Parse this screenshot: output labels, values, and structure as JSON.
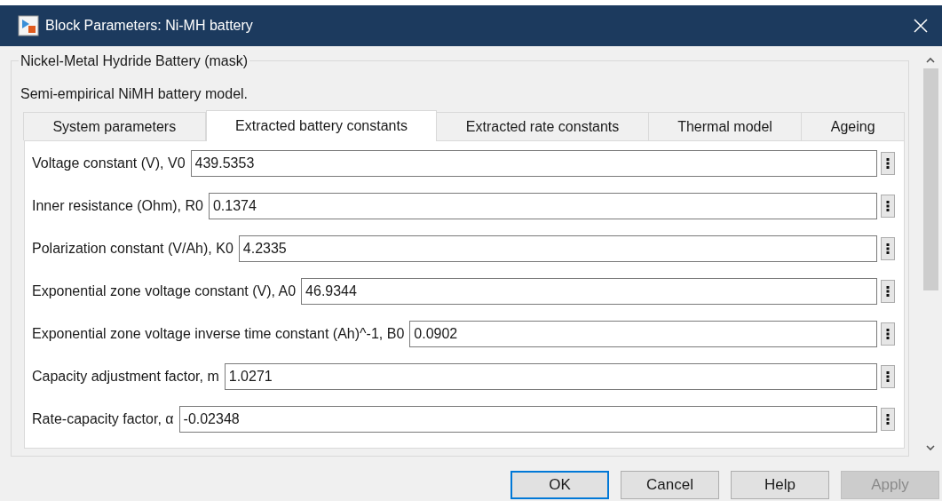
{
  "window": {
    "title": "Block Parameters: Ni-MH battery"
  },
  "group": {
    "title": "Nickel-Metal Hydride Battery (mask)",
    "description": "Semi-empirical NiMH battery model."
  },
  "tabs": [
    {
      "label": "System parameters",
      "selected": false
    },
    {
      "label": "Extracted battery constants",
      "selected": true
    },
    {
      "label": "Extracted rate constants",
      "selected": false
    },
    {
      "label": "Thermal model",
      "selected": false
    },
    {
      "label": "Ageing",
      "selected": false
    }
  ],
  "parameters": [
    {
      "label": "Voltage constant (V), V0",
      "value": "439.5353"
    },
    {
      "label": "Inner resistance (Ohm), R0",
      "value": "0.1374"
    },
    {
      "label": "Polarization constant (V/Ah), K0",
      "value": "4.2335"
    },
    {
      "label": "Exponential zone voltage constant (V), A0",
      "value": "46.9344"
    },
    {
      "label": "Exponential zone voltage inverse time constant (Ah)^-1, B0",
      "value": "0.0902"
    },
    {
      "label": "Capacity adjustment factor, m",
      "value": "1.0271"
    },
    {
      "label": "Rate-capacity factor, α",
      "value": "-0.02348"
    }
  ],
  "buttons": [
    {
      "label": "OK",
      "default": true,
      "disabled": false
    },
    {
      "label": "Cancel",
      "default": false,
      "disabled": false
    },
    {
      "label": "Help",
      "default": false,
      "disabled": false
    },
    {
      "label": "Apply",
      "default": false,
      "disabled": true
    }
  ]
}
